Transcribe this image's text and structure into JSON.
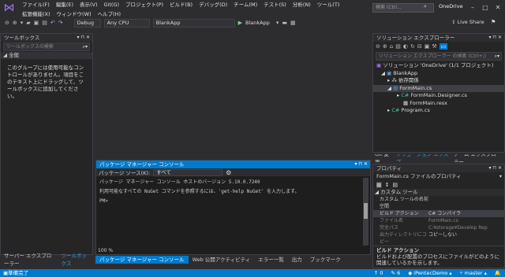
{
  "menu": [
    "ファイル(F)",
    "編集(E)",
    "表示(V)",
    "Git(G)",
    "プロジェクト(P)",
    "ビルド(B)",
    "デバッグ(D)",
    "チーム(M)",
    "テスト(S)",
    "分析(N)",
    "ツール(T)",
    "拡張機能(X)",
    "ウィンドウ(W)",
    "ヘルプ(H)"
  ],
  "title": {
    "search_placeholder": "検索 (Ctrl...",
    "solution_name": "OneDrive"
  },
  "toolbar": {
    "config": "Debug",
    "platform": "Any CPU",
    "project": "BlankApp",
    "run_label": "BlankApp",
    "live_share": "Live Share"
  },
  "toolbox": {
    "title": "ツールボックス",
    "search_placeholder": "ツールボックスの検索",
    "group": "全般",
    "empty_message": "このグループには使用可能なコントロールがありません。項目をこのテキスト上にドラッグして、ツールボックスに追加してください。",
    "tabs": [
      "サーバー エクスプローラー",
      "ツールボックス"
    ]
  },
  "console": {
    "title": "パッケージ マネージャー コンソール",
    "source_label": "パッケージ ソース(K):",
    "source_value": "すべて",
    "lines": [
      "パッケージ マネージャー コンソール ホストのバージョン 5.10.0.7240",
      "利用可能なすべての NuGet コマンドを参照するには、'get-help NuGet' を入力します。",
      "PM>"
    ],
    "zoom": "100 %",
    "tabs": [
      "パッケージ マネージャー コンソール",
      "Web 公開アクティビティ",
      "エラー一覧",
      "出力",
      "ブックマーク"
    ]
  },
  "solution_explorer": {
    "title": "ソリューション エクスプローラー",
    "search_placeholder": "ソリューション エクスプローラー の検索 (Ctrl+;)",
    "items": [
      "ソリューション 'OneDrive' (1/1 プロジェクト)",
      "BlankApp",
      "依存関係",
      "FormMain.cs",
      "FormMain.Designer.cs",
      "FormMain.resx",
      "Program.cs"
    ],
    "tabs": [
      "Git 変更",
      "ソリューション エクスプ...",
      "チーム エクスプローラー"
    ]
  },
  "properties": {
    "title": "プロパティ",
    "object": "FormMain.cs ファイルのプロパティ",
    "category": "カスタム ツール",
    "rows": [
      {
        "k": "カスタム ツールの名前空間",
        "v": ""
      },
      {
        "k": "ビルド アクション",
        "v": "C# コンパイラ"
      },
      {
        "k": "ファイル名",
        "v": "FormMain.cs"
      },
      {
        "k": "完全パス",
        "v": "C:¥storage¥Develop Rep"
      },
      {
        "k": "出力ディレクトリにコピー",
        "v": "コピーしない"
      }
    ],
    "desc_title": "ビルド アクション",
    "desc_text": "ビルドおよび配置のプロセスにファイルがどのように関連しているかを示します。"
  },
  "status": {
    "ready": "準備完了",
    "up": "0",
    "pencil": "6",
    "repo": "iPentecDemo",
    "branch": "master"
  }
}
